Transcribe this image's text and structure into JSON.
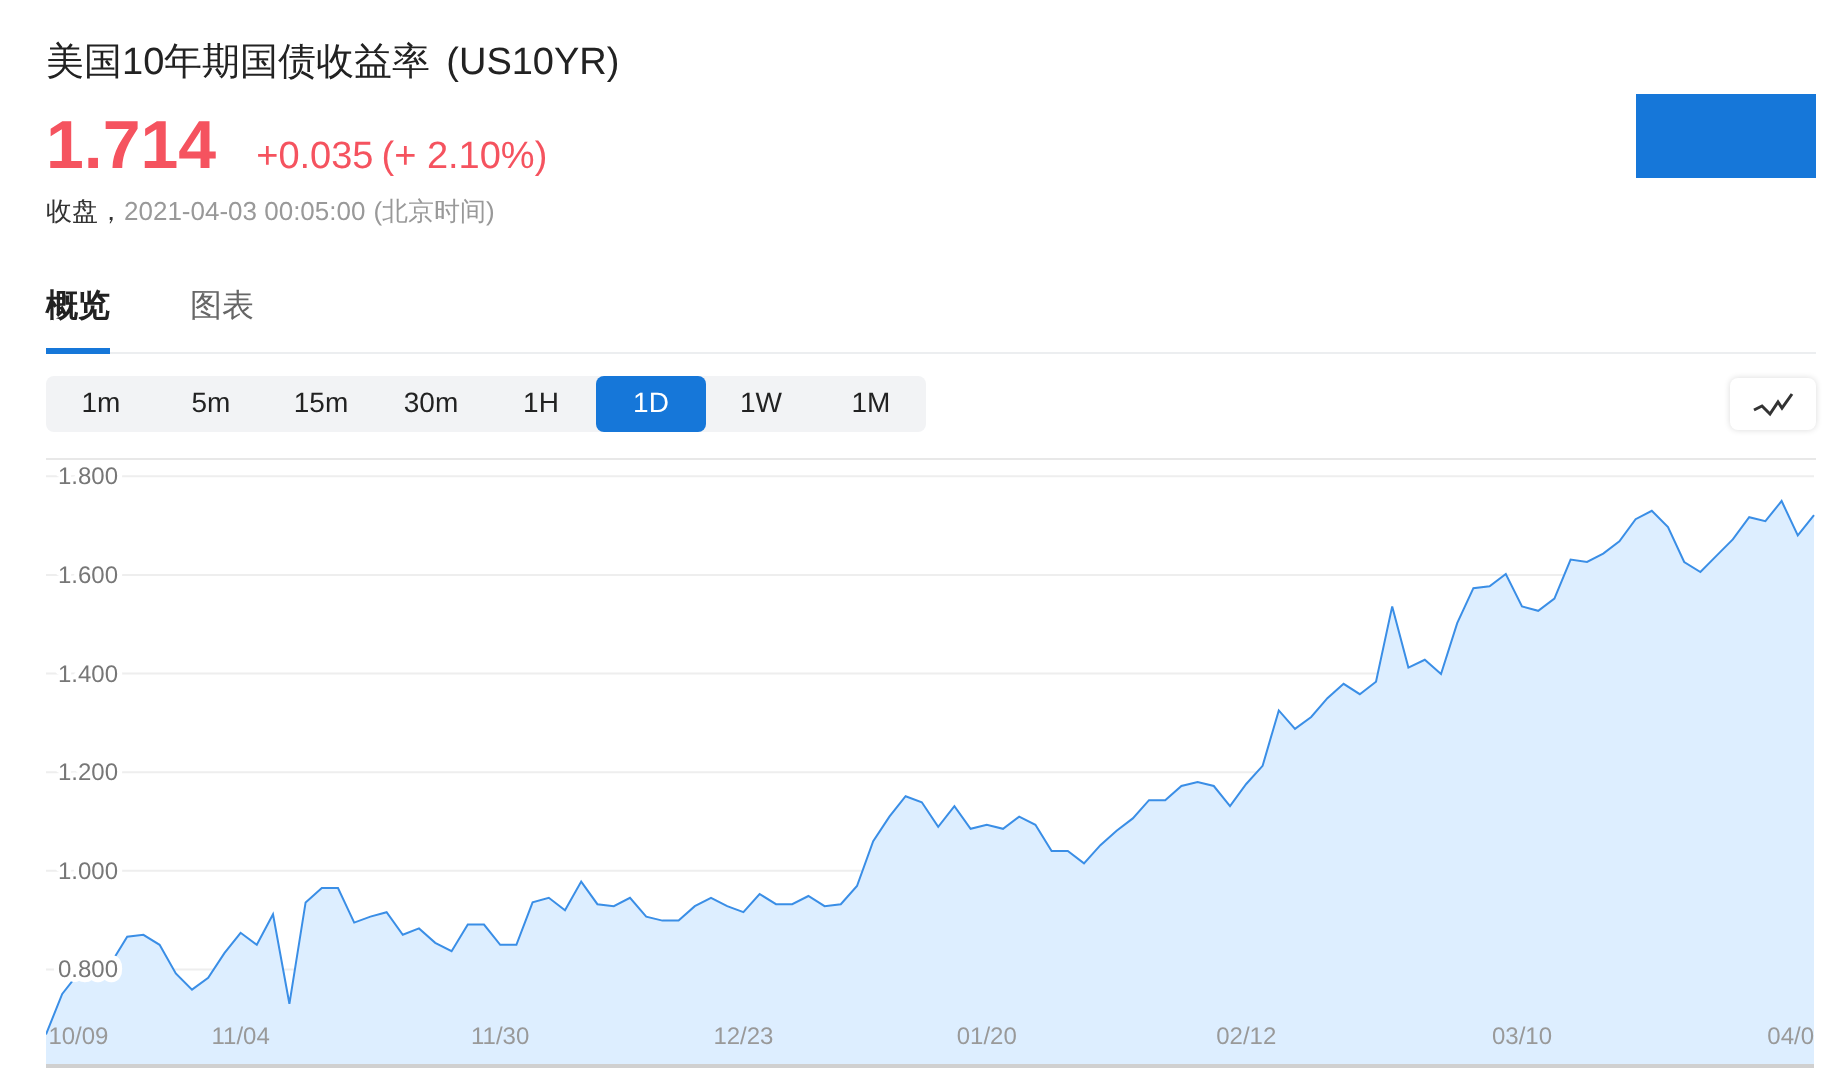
{
  "title": {
    "name": "美国10年期国债收益率",
    "symbol": "(US10YR)"
  },
  "quote": {
    "price": "1.714",
    "change": "+0.035",
    "change_pct": "(+ 2.10%)"
  },
  "status": {
    "label": "收盘，",
    "time": "2021-04-03 00:05:00",
    "timezone": "(北京时间)"
  },
  "action_button": {
    "kind": "button"
  },
  "tabs": [
    {
      "label": "概览",
      "selected": true
    },
    {
      "label": "图表",
      "selected": false
    }
  ],
  "intervals": [
    {
      "label": "1m",
      "selected": false
    },
    {
      "label": "5m",
      "selected": false
    },
    {
      "label": "15m",
      "selected": false
    },
    {
      "label": "30m",
      "selected": false
    },
    {
      "label": "1H",
      "selected": false
    },
    {
      "label": "1D",
      "selected": true
    },
    {
      "label": "1W",
      "selected": false
    },
    {
      "label": "1M",
      "selected": false
    }
  ],
  "line_toggle": {
    "selected": false
  },
  "chart_data": {
    "type": "area",
    "grid": true,
    "ylim": [
      0.6,
      1.833
    ],
    "yticks": [
      {
        "value": 0.8,
        "label": "0.800"
      },
      {
        "value": 1.0,
        "label": "1.000"
      },
      {
        "value": 1.2,
        "label": "1.200"
      },
      {
        "value": 1.4,
        "label": "1.400"
      },
      {
        "value": 1.6,
        "label": "1.600"
      },
      {
        "value": 1.8,
        "label": "1.800"
      }
    ],
    "categories": [
      null,
      null,
      "10/09",
      null,
      null,
      null,
      null,
      null,
      null,
      null,
      null,
      null,
      "11/04",
      null,
      null,
      null,
      null,
      null,
      null,
      null,
      null,
      null,
      null,
      null,
      null,
      null,
      null,
      null,
      "11/30",
      null,
      null,
      null,
      null,
      null,
      null,
      null,
      null,
      null,
      null,
      null,
      null,
      null,
      null,
      "12/23",
      null,
      null,
      null,
      null,
      null,
      null,
      null,
      null,
      null,
      null,
      null,
      null,
      null,
      null,
      "01/20",
      null,
      null,
      null,
      null,
      null,
      null,
      null,
      null,
      null,
      null,
      null,
      null,
      null,
      null,
      null,
      "02/12",
      null,
      null,
      null,
      null,
      null,
      null,
      null,
      null,
      null,
      null,
      null,
      null,
      null,
      null,
      null,
      null,
      "03/10",
      null,
      null,
      null,
      null,
      null,
      null,
      null,
      null,
      null,
      null,
      null,
      null,
      null,
      null,
      null,
      null,
      "04/0",
      null
    ],
    "series": [
      {
        "color": "#3a8ee6",
        "values": [
          0.668,
          0.75,
          0.792,
          0.8,
          0.812,
          0.866,
          0.87,
          0.85,
          0.792,
          0.759,
          0.783,
          0.833,
          0.874,
          0.85,
          0.912,
          0.73,
          0.936,
          0.965,
          0.965,
          0.895,
          0.907,
          0.916,
          0.87,
          0.883,
          0.854,
          0.837,
          0.891,
          0.891,
          0.85,
          0.85,
          0.936,
          0.945,
          0.92,
          0.978,
          0.932,
          0.928,
          0.945,
          0.907,
          0.899,
          0.899,
          0.928,
          0.945,
          0.928,
          0.916,
          0.953,
          0.932,
          0.932,
          0.949,
          0.928,
          0.932,
          0.969,
          1.06,
          1.11,
          1.151,
          1.139,
          1.089,
          1.131,
          1.085,
          1.093,
          1.085,
          1.11,
          1.093,
          1.04,
          1.04,
          1.015,
          1.052,
          1.081,
          1.106,
          1.143,
          1.143,
          1.172,
          1.18,
          1.172,
          1.131,
          1.176,
          1.213,
          1.325,
          1.288,
          1.312,
          1.35,
          1.379,
          1.358,
          1.383,
          1.536,
          1.412,
          1.428,
          1.399,
          1.502,
          1.573,
          1.577,
          1.602,
          1.536,
          1.527,
          1.552,
          1.631,
          1.626,
          1.643,
          1.668,
          1.713,
          1.73,
          1.697,
          1.626,
          1.606,
          1.639,
          1.672,
          1.717,
          1.709,
          1.75,
          1.68,
          1.721
        ]
      }
    ]
  }
}
